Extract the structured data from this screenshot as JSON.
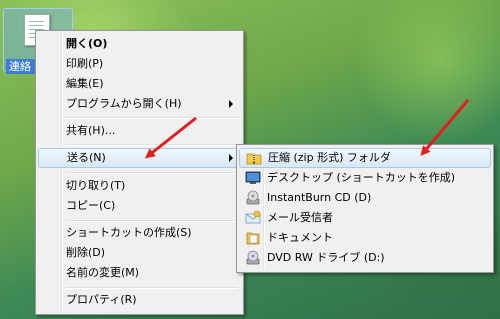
{
  "desktop": {
    "icon_label": "連絡"
  },
  "context_menu": {
    "items": [
      {
        "label": "開く(O)",
        "bold": true
      },
      {
        "label": "印刷(P)"
      },
      {
        "label": "編集(E)"
      },
      {
        "label": "プログラムから開く(H)",
        "submenu": true
      },
      {
        "label": "共有(H)..."
      },
      {
        "label": "送る(N)",
        "submenu": true,
        "highlighted": true
      },
      {
        "label": "切り取り(T)"
      },
      {
        "label": "コピー(C)"
      },
      {
        "label": "ショートカットの作成(S)"
      },
      {
        "label": "削除(D)"
      },
      {
        "label": "名前の変更(M)"
      },
      {
        "label": "プロパティ(R)"
      }
    ]
  },
  "sendto_menu": {
    "items": [
      {
        "label": "圧縮 (zip 形式) フォルダ",
        "icon": "zip-folder-icon",
        "highlighted": true
      },
      {
        "label": "デスクトップ (ショートカットを作成)",
        "icon": "desktop-icon"
      },
      {
        "label": "InstantBurn CD (D)",
        "icon": "cd-drive-icon"
      },
      {
        "label": "メール受信者",
        "icon": "mail-recipient-icon"
      },
      {
        "label": "ドキュメント",
        "icon": "documents-folder-icon"
      },
      {
        "label": "DVD RW ドライブ (D:)",
        "icon": "dvd-drive-icon"
      }
    ]
  },
  "colors": {
    "highlight_border": "#aac9e8",
    "annotation_arrow": "#e02020"
  }
}
